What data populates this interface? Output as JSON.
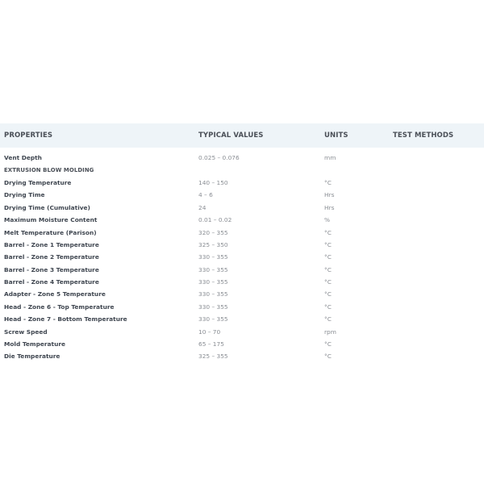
{
  "header": {
    "properties": "PROPERTIES",
    "typical_values": "TYPICAL VALUES",
    "units": "UNITS",
    "test_methods": "TEST METHODS"
  },
  "rows": [
    {
      "property": "Vent Depth",
      "value": "0.025 – 0.076",
      "unit": "mm",
      "method": ""
    },
    {
      "property": "EXTRUSION BLOW MOLDING",
      "value": "",
      "unit": "",
      "method": ""
    },
    {
      "property": "Drying Temperature",
      "value": "140 – 150",
      "unit": "°C",
      "method": ""
    },
    {
      "property": "Drying Time",
      "value": "4 – 6",
      "unit": "Hrs",
      "method": ""
    },
    {
      "property": "Drying Time (Cumulative)",
      "value": "24",
      "unit": "Hrs",
      "method": ""
    },
    {
      "property": "Maximum Moisture Content",
      "value": "0.01 – 0.02",
      "unit": "%",
      "method": ""
    },
    {
      "property": "Melt Temperature (Parison)",
      "value": "320 – 355",
      "unit": "°C",
      "method": ""
    },
    {
      "property": "Barrel - Zone 1 Temperature",
      "value": "325 – 350",
      "unit": "°C",
      "method": ""
    },
    {
      "property": "Barrel - Zone 2 Temperature",
      "value": "330 – 355",
      "unit": "°C",
      "method": ""
    },
    {
      "property": "Barrel - Zone 3 Temperature",
      "value": "330 – 355",
      "unit": "°C",
      "method": ""
    },
    {
      "property": "Barrel - Zone 4 Temperature",
      "value": "330 – 355",
      "unit": "°C",
      "method": ""
    },
    {
      "property": "Adapter - Zone 5 Temperature",
      "value": "330 – 355",
      "unit": "°C",
      "method": ""
    },
    {
      "property": "Head - Zone 6 - Top Temperature",
      "value": "330 – 355",
      "unit": "°C",
      "method": ""
    },
    {
      "property": "Head - Zone 7 - Bottom Temperature",
      "value": "330 – 355",
      "unit": "°C",
      "method": ""
    },
    {
      "property": "Screw Speed",
      "value": "10 – 70",
      "unit": "rpm",
      "method": ""
    },
    {
      "property": "Mold Temperature",
      "value": "65 – 175",
      "unit": "°C",
      "method": ""
    },
    {
      "property": "Die Temperature",
      "value": "325 – 355",
      "unit": "°C",
      "method": ""
    }
  ]
}
